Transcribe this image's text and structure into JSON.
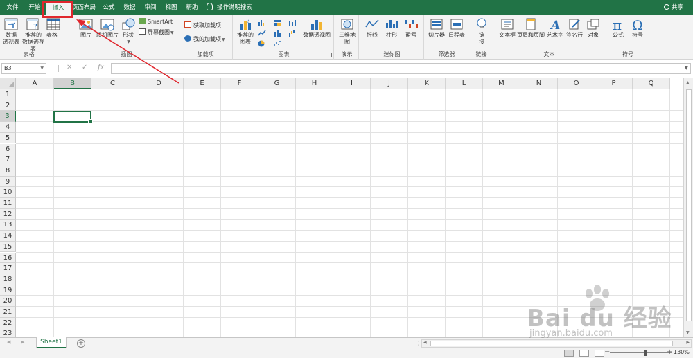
{
  "tabs": [
    {
      "label": "文件",
      "active": false
    },
    {
      "label": "开始",
      "active": false
    },
    {
      "label": "插入",
      "active": true
    },
    {
      "label": "页面布局",
      "active": false
    },
    {
      "label": "公式",
      "active": false
    },
    {
      "label": "数据",
      "active": false
    },
    {
      "label": "审阅",
      "active": false
    },
    {
      "label": "视图",
      "active": false
    },
    {
      "label": "帮助",
      "active": false
    }
  ],
  "tell_me": "操作说明搜索",
  "share_label": "共享",
  "ribbon": {
    "tables": {
      "label": "表格",
      "pivot_table": "数据\n透视表",
      "recommended_pivot": "推荐的\n数据透视表",
      "table": "表格"
    },
    "illustrations": {
      "label": "插图",
      "pictures": "图片",
      "online_pictures": "联机图片",
      "shapes": "形状",
      "smartart": "SmartArt",
      "screenshot": "屏幕截图"
    },
    "addins": {
      "label": "加载项",
      "get_addins": "获取加载项",
      "my_addins": "我的加载项"
    },
    "charts": {
      "label": "图表",
      "recommended_charts": "推荐的\n图表",
      "pivot_chart": "数据透视图"
    },
    "tours": {
      "label": "演示",
      "map_3d": "三维地\n图"
    },
    "sparklines": {
      "label": "迷你图",
      "line": "折线",
      "column": "柱形",
      "win_loss": "盈亏"
    },
    "filters": {
      "label": "筛选器",
      "slicer": "切片器",
      "timeline": "日程表"
    },
    "links": {
      "label": "链接",
      "link": "链\n接"
    },
    "text": {
      "label": "文本",
      "text_box": "文本框",
      "header_footer": "页眉和页脚",
      "wordart": "艺术字",
      "signature_line": "签名行",
      "object": "对象"
    },
    "symbols": {
      "label": "符号",
      "equation": "公式",
      "symbol": "符号"
    }
  },
  "formula_bar": {
    "name_box": "B3",
    "fx": "fx",
    "cancel": "✕",
    "enter": "✓"
  },
  "columns": [
    "A",
    "B",
    "C",
    "D",
    "E",
    "F",
    "G",
    "H",
    "I",
    "J",
    "K",
    "L",
    "M",
    "N",
    "O",
    "P",
    "Q"
  ],
  "rows": [
    "1",
    "2",
    "3",
    "4",
    "5",
    "6",
    "7",
    "8",
    "9",
    "10",
    "11",
    "12",
    "13",
    "14",
    "15",
    "16",
    "17",
    "18",
    "19",
    "20",
    "21",
    "22",
    "23"
  ],
  "selected_cell": {
    "col": "B",
    "row": "3"
  },
  "sheets": [
    {
      "name": "Sheet1",
      "active": true
    }
  ],
  "zoom": "130%",
  "watermark": {
    "brand": "Bai du 经验",
    "url": "jingyan.baidu.com"
  },
  "colors": {
    "accent": "#217346",
    "highlight": "#e0262d"
  }
}
